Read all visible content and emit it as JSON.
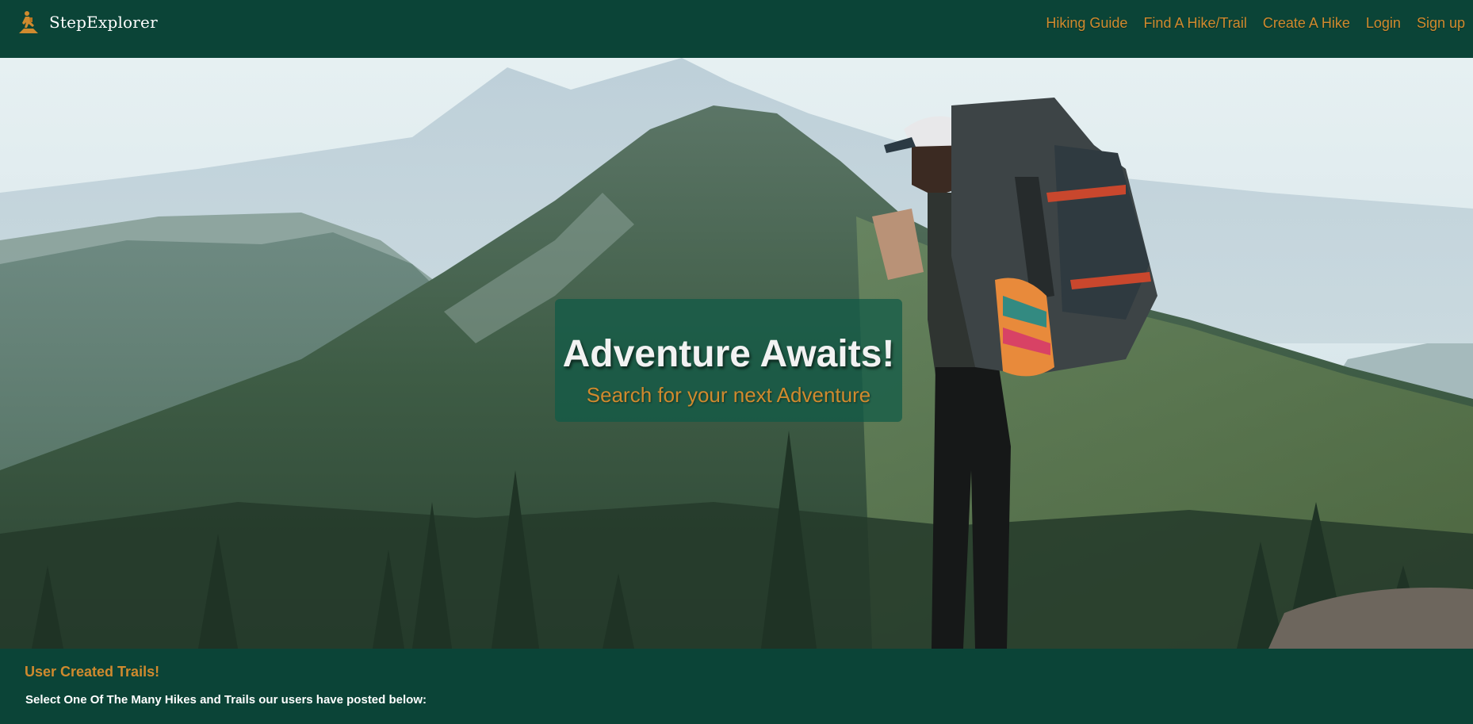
{
  "brand": {
    "name": "StepExplorer",
    "logo_icon": "hiker-icon",
    "accent_color": "#d08a2e",
    "background_color": "#0b4437"
  },
  "nav": {
    "links": [
      {
        "label": "Hiking Guide"
      },
      {
        "label": "Find A Hike/Trail"
      },
      {
        "label": "Create A Hike"
      },
      {
        "label": "Login"
      },
      {
        "label": "Sign up"
      }
    ]
  },
  "hero": {
    "image": "hiker-with-backpack-mountain-photo",
    "title": "Adventure Awaits!",
    "subtitle": "Search for your next Adventure"
  },
  "trails_section": {
    "title": "User Created Trails!",
    "description": "Select One Of The Many Hikes and Trails our users have posted below:"
  }
}
